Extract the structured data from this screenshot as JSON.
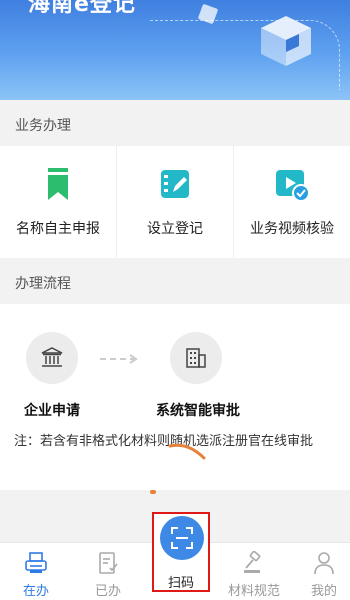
{
  "banner": {
    "title": "海南e登记"
  },
  "sections": {
    "business": "业务办理",
    "process": "办理流程"
  },
  "services": [
    {
      "label": "名称自主申报",
      "icon": "bookmark-icon",
      "color": "#2dbd6e"
    },
    {
      "label": "设立登记",
      "icon": "notebook-edit-icon",
      "color": "#22b8c8"
    },
    {
      "label": "业务视频核验",
      "icon": "video-check-icon",
      "color": "#22b8c8"
    }
  ],
  "flow": {
    "steps": [
      {
        "label": "企业申请",
        "icon": "bank-building-icon"
      },
      {
        "label": "系统智能审批",
        "icon": "office-building-icon"
      }
    ],
    "note": "注：若含有非格式化材料则随机选派注册官在线审批"
  },
  "tabbar": {
    "tabs": [
      {
        "label": "在办",
        "icon": "printer-doc-icon",
        "active": true
      },
      {
        "label": "已办",
        "icon": "doc-check-icon",
        "active": false
      },
      {
        "label": "扫码",
        "icon": "scan-icon",
        "active": false
      },
      {
        "label": "材料规范",
        "icon": "gavel-icon",
        "active": false
      },
      {
        "label": "我的",
        "icon": "user-icon",
        "active": false
      }
    ],
    "active_color": "#2f7be5",
    "inactive_color": "#999999"
  }
}
